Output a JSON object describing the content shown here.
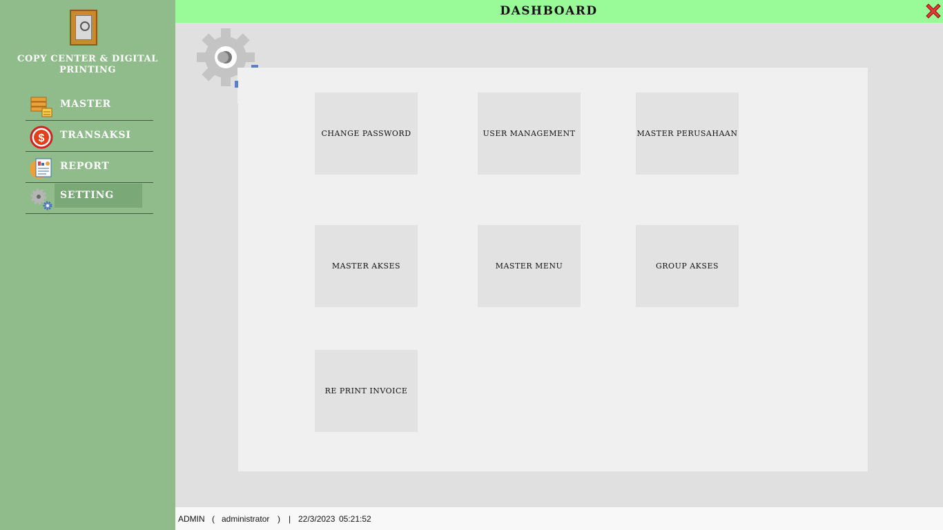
{
  "sidebar": {
    "brand": "COPY CENTER & DIGITAL PRINTING",
    "items": [
      {
        "label": "MASTER",
        "icon": "database-icon"
      },
      {
        "label": "TRANSAKSI",
        "icon": "dollar-icon"
      },
      {
        "label": "REPORT",
        "icon": "report-icon"
      },
      {
        "label": "SETTING",
        "icon": "gear-icon",
        "active": true
      }
    ]
  },
  "header": {
    "title": "DASHBOARD"
  },
  "tiles": [
    {
      "label": "CHANGE PASSWORD"
    },
    {
      "label": "USER MANAGEMENT"
    },
    {
      "label": "MASTER PERUSAHAAN"
    },
    {
      "label": "MASTER AKSES"
    },
    {
      "label": "MASTER MENU"
    },
    {
      "label": "GROUP AKSES"
    },
    {
      "label": "RE PRINT INVOICE"
    }
  ],
  "status": {
    "role": "ADMIN",
    "open": "(",
    "user": "administrator",
    "close": ")",
    "sep": "|",
    "date": "22/3/2023",
    "time": "05:21:52"
  },
  "colors": {
    "sidebar_bg": "#8fbc8a",
    "header_bg": "#98fb98",
    "active_item": "#7aa876",
    "close_red": "#e03a3a"
  }
}
